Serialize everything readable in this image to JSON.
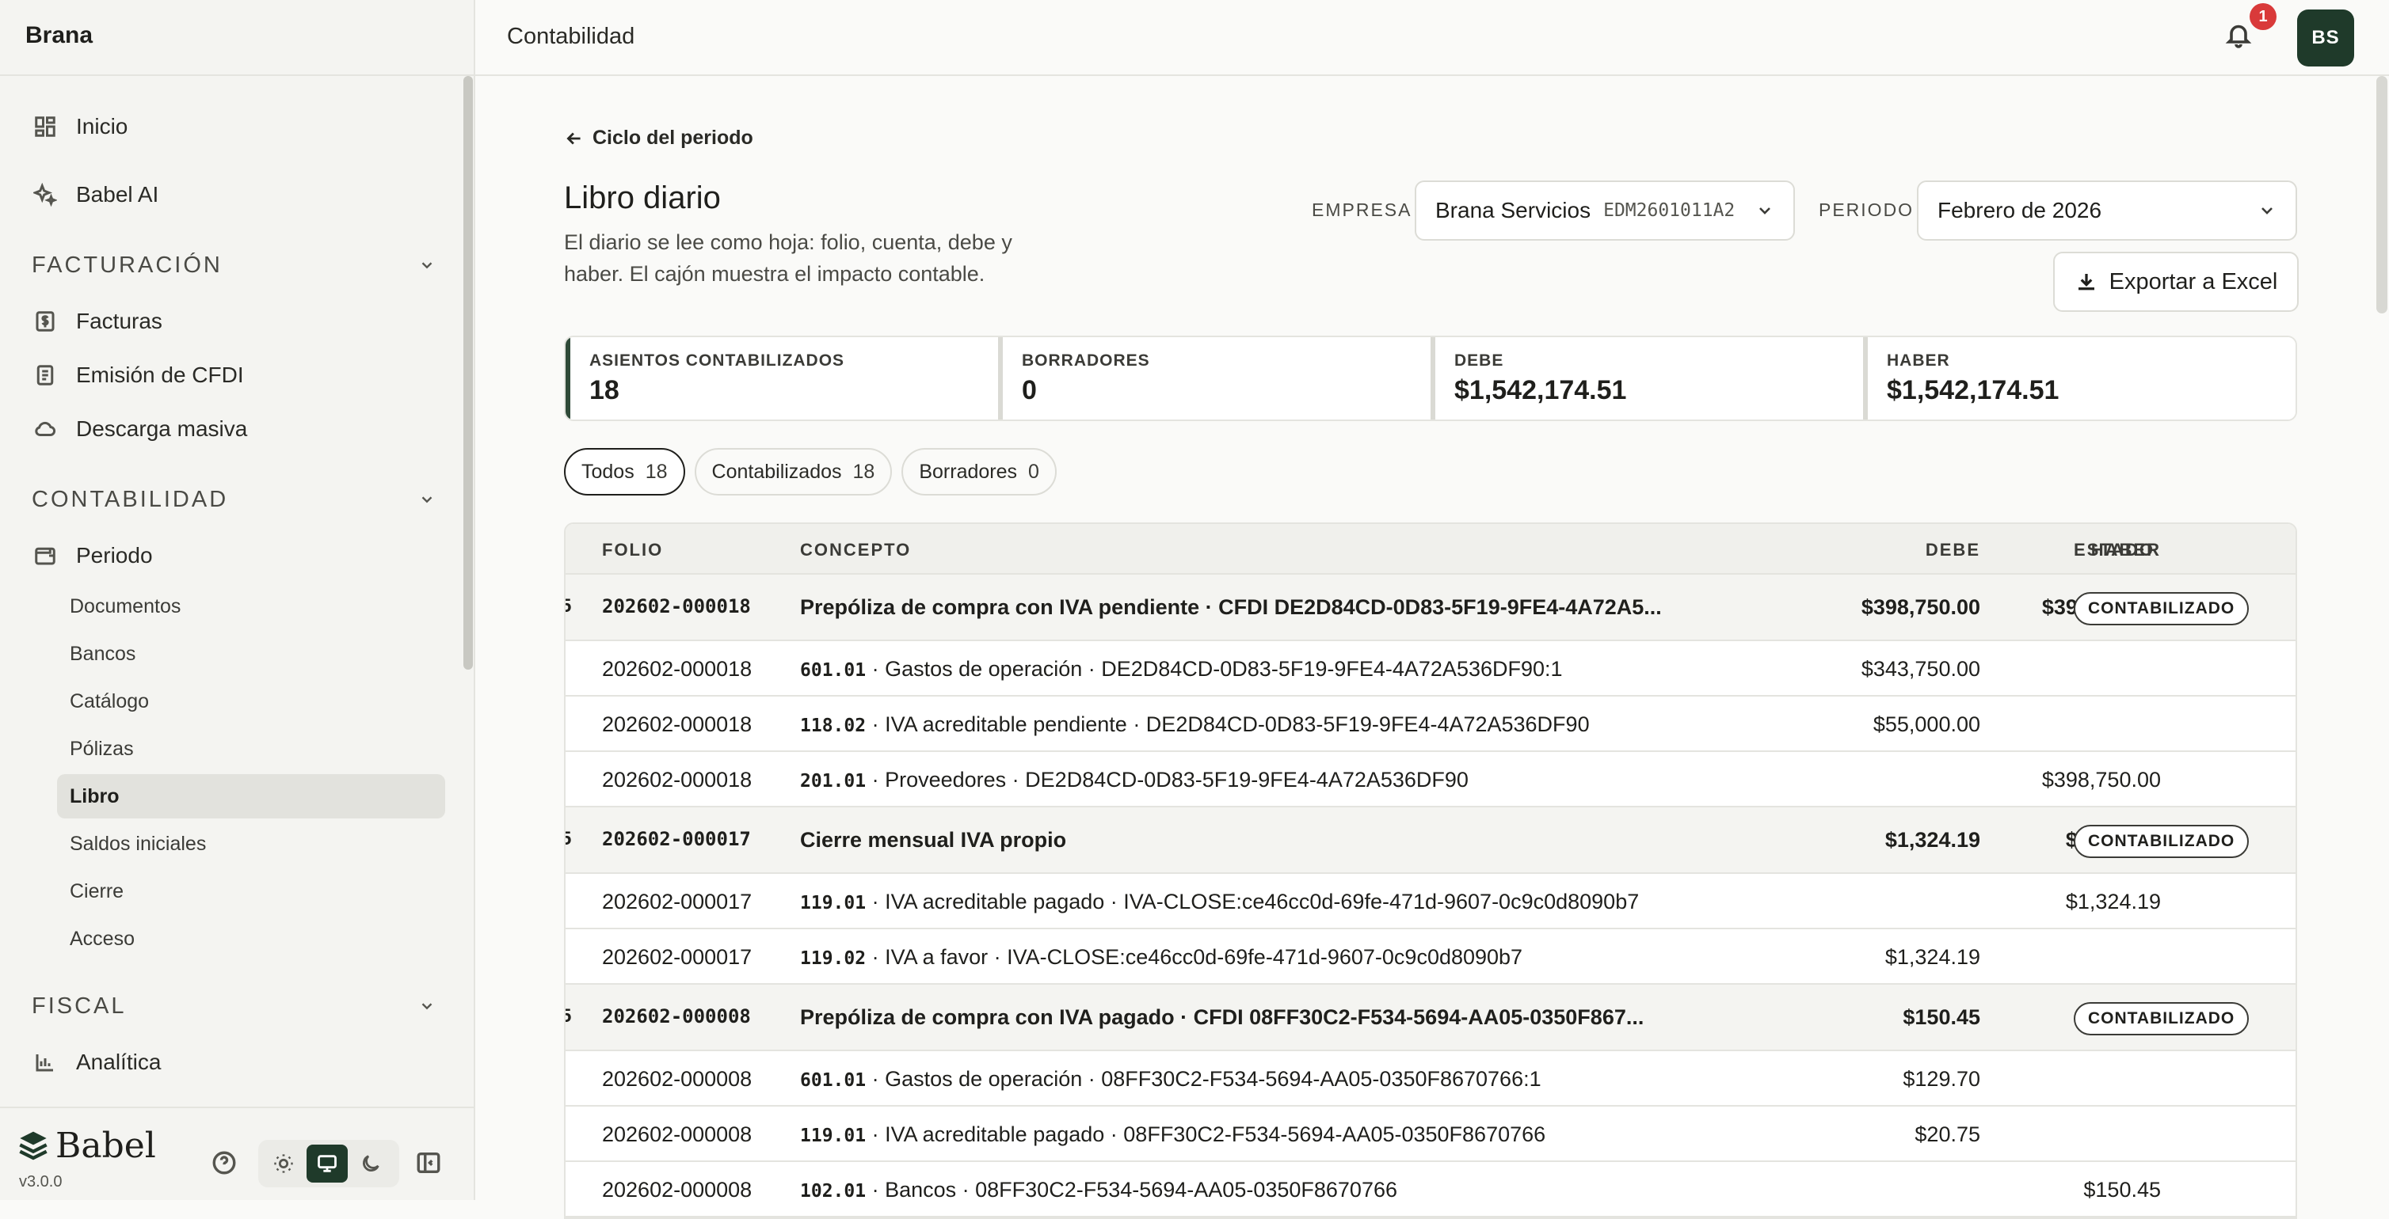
{
  "app": {
    "brand": "Brana",
    "topbar_title": "Contabilidad",
    "notifications": "1",
    "avatar": "BS",
    "logo": "Babel",
    "version": "v3.0.0"
  },
  "sidebar": {
    "inicio": "Inicio",
    "babel_ai": "Babel AI",
    "facturacion": {
      "title": "FACTURACIÓN",
      "items": [
        "Facturas",
        "Emisión de CFDI",
        "Descarga masiva"
      ]
    },
    "contabilidad": {
      "title": "CONTABILIDAD",
      "periodo": "Periodo",
      "sub": [
        "Documentos",
        "Bancos",
        "Catálogo",
        "Pólizas",
        "Libro",
        "Saldos iniciales",
        "Cierre",
        "Acceso"
      ]
    },
    "fiscal": {
      "title": "FISCAL",
      "items": [
        "Analítica"
      ]
    }
  },
  "page": {
    "back": "Ciclo del periodo",
    "title": "Libro diario",
    "subtitle": "El diario se lee como hoja: folio, cuenta, debe y haber. El cajón muestra el impacto contable.",
    "empresa_label": "EMPRESA",
    "empresa_value": "Brana Servicios",
    "empresa_code": "EDM2601011A2",
    "periodo_label": "PERIODO",
    "periodo_value": "Febrero de 2026",
    "export": "Exportar a Excel"
  },
  "stats": [
    {
      "label": "ASIENTOS CONTABILIZADOS",
      "value": "18"
    },
    {
      "label": "BORRADORES",
      "value": "0"
    },
    {
      "label": "DEBE",
      "value": "$1,542,174.51"
    },
    {
      "label": "HABER",
      "value": "$1,542,174.51"
    }
  ],
  "filters": [
    {
      "label": "Todos",
      "count": "18"
    },
    {
      "label": "Contabilizados",
      "count": "18"
    },
    {
      "label": "Borradores",
      "count": "0"
    }
  ],
  "table": {
    "headers": {
      "folio": "FOLIO",
      "concepto": "CONCEPTO",
      "debe": "DEBE",
      "haber": "HABER",
      "estado": "ESTADO"
    },
    "groups": [
      {
        "edge": "5",
        "folio": "202602-000018",
        "concepto": "Prepóliza de compra con IVA pendiente · CFDI DE2D84CD-0D83-5F19-9FE4-4A72A5...",
        "debe": "$398,750.00",
        "haber": "$398,750.00",
        "estado": "CONTABILIZADO",
        "lines": [
          {
            "folio": "202602-000018",
            "cuenta": "601.01",
            "desc": " · Gastos de operación · DE2D84CD-0D83-5F19-9FE4-4A72A536DF90:1",
            "debe": "$343,750.00",
            "haber": ""
          },
          {
            "folio": "202602-000018",
            "cuenta": "118.02",
            "desc": " · IVA acreditable pendiente · DE2D84CD-0D83-5F19-9FE4-4A72A536DF90",
            "debe": "$55,000.00",
            "haber": ""
          },
          {
            "folio": "202602-000018",
            "cuenta": "201.01",
            "desc": " · Proveedores · DE2D84CD-0D83-5F19-9FE4-4A72A536DF90",
            "debe": "",
            "haber": "$398,750.00"
          }
        ]
      },
      {
        "edge": "5",
        "folio": "202602-000017",
        "concepto": "Cierre mensual IVA propio",
        "debe": "$1,324.19",
        "haber": "$1,324.19",
        "estado": "CONTABILIZADO",
        "lines": [
          {
            "folio": "202602-000017",
            "cuenta": "119.01",
            "desc": " · IVA acreditable pagado · IVA-CLOSE:ce46cc0d-69fe-471d-9607-0c9c0d8090b7",
            "debe": "",
            "haber": "$1,324.19"
          },
          {
            "folio": "202602-000017",
            "cuenta": "119.02",
            "desc": " · IVA a favor · IVA-CLOSE:ce46cc0d-69fe-471d-9607-0c9c0d8090b7",
            "debe": "$1,324.19",
            "haber": ""
          }
        ]
      },
      {
        "edge": "5",
        "folio": "202602-000008",
        "concepto": "Prepóliza de compra con IVA pagado · CFDI 08FF30C2-F534-5694-AA05-0350F867...",
        "debe": "$150.45",
        "haber": "$150.45",
        "estado": "CONTABILIZADO",
        "lines": [
          {
            "folio": "202602-000008",
            "cuenta": "601.01",
            "desc": " · Gastos de operación · 08FF30C2-F534-5694-AA05-0350F8670766:1",
            "debe": "$129.70",
            "haber": ""
          },
          {
            "folio": "202602-000008",
            "cuenta": "119.01",
            "desc": " · IVA acreditable pagado · 08FF30C2-F534-5694-AA05-0350F8670766",
            "debe": "$20.75",
            "haber": ""
          },
          {
            "folio": "202602-000008",
            "cuenta": "102.01",
            "desc": " · Bancos · 08FF30C2-F534-5694-AA05-0350F8670766",
            "debe": "",
            "haber": "$150.45"
          }
        ]
      }
    ]
  }
}
